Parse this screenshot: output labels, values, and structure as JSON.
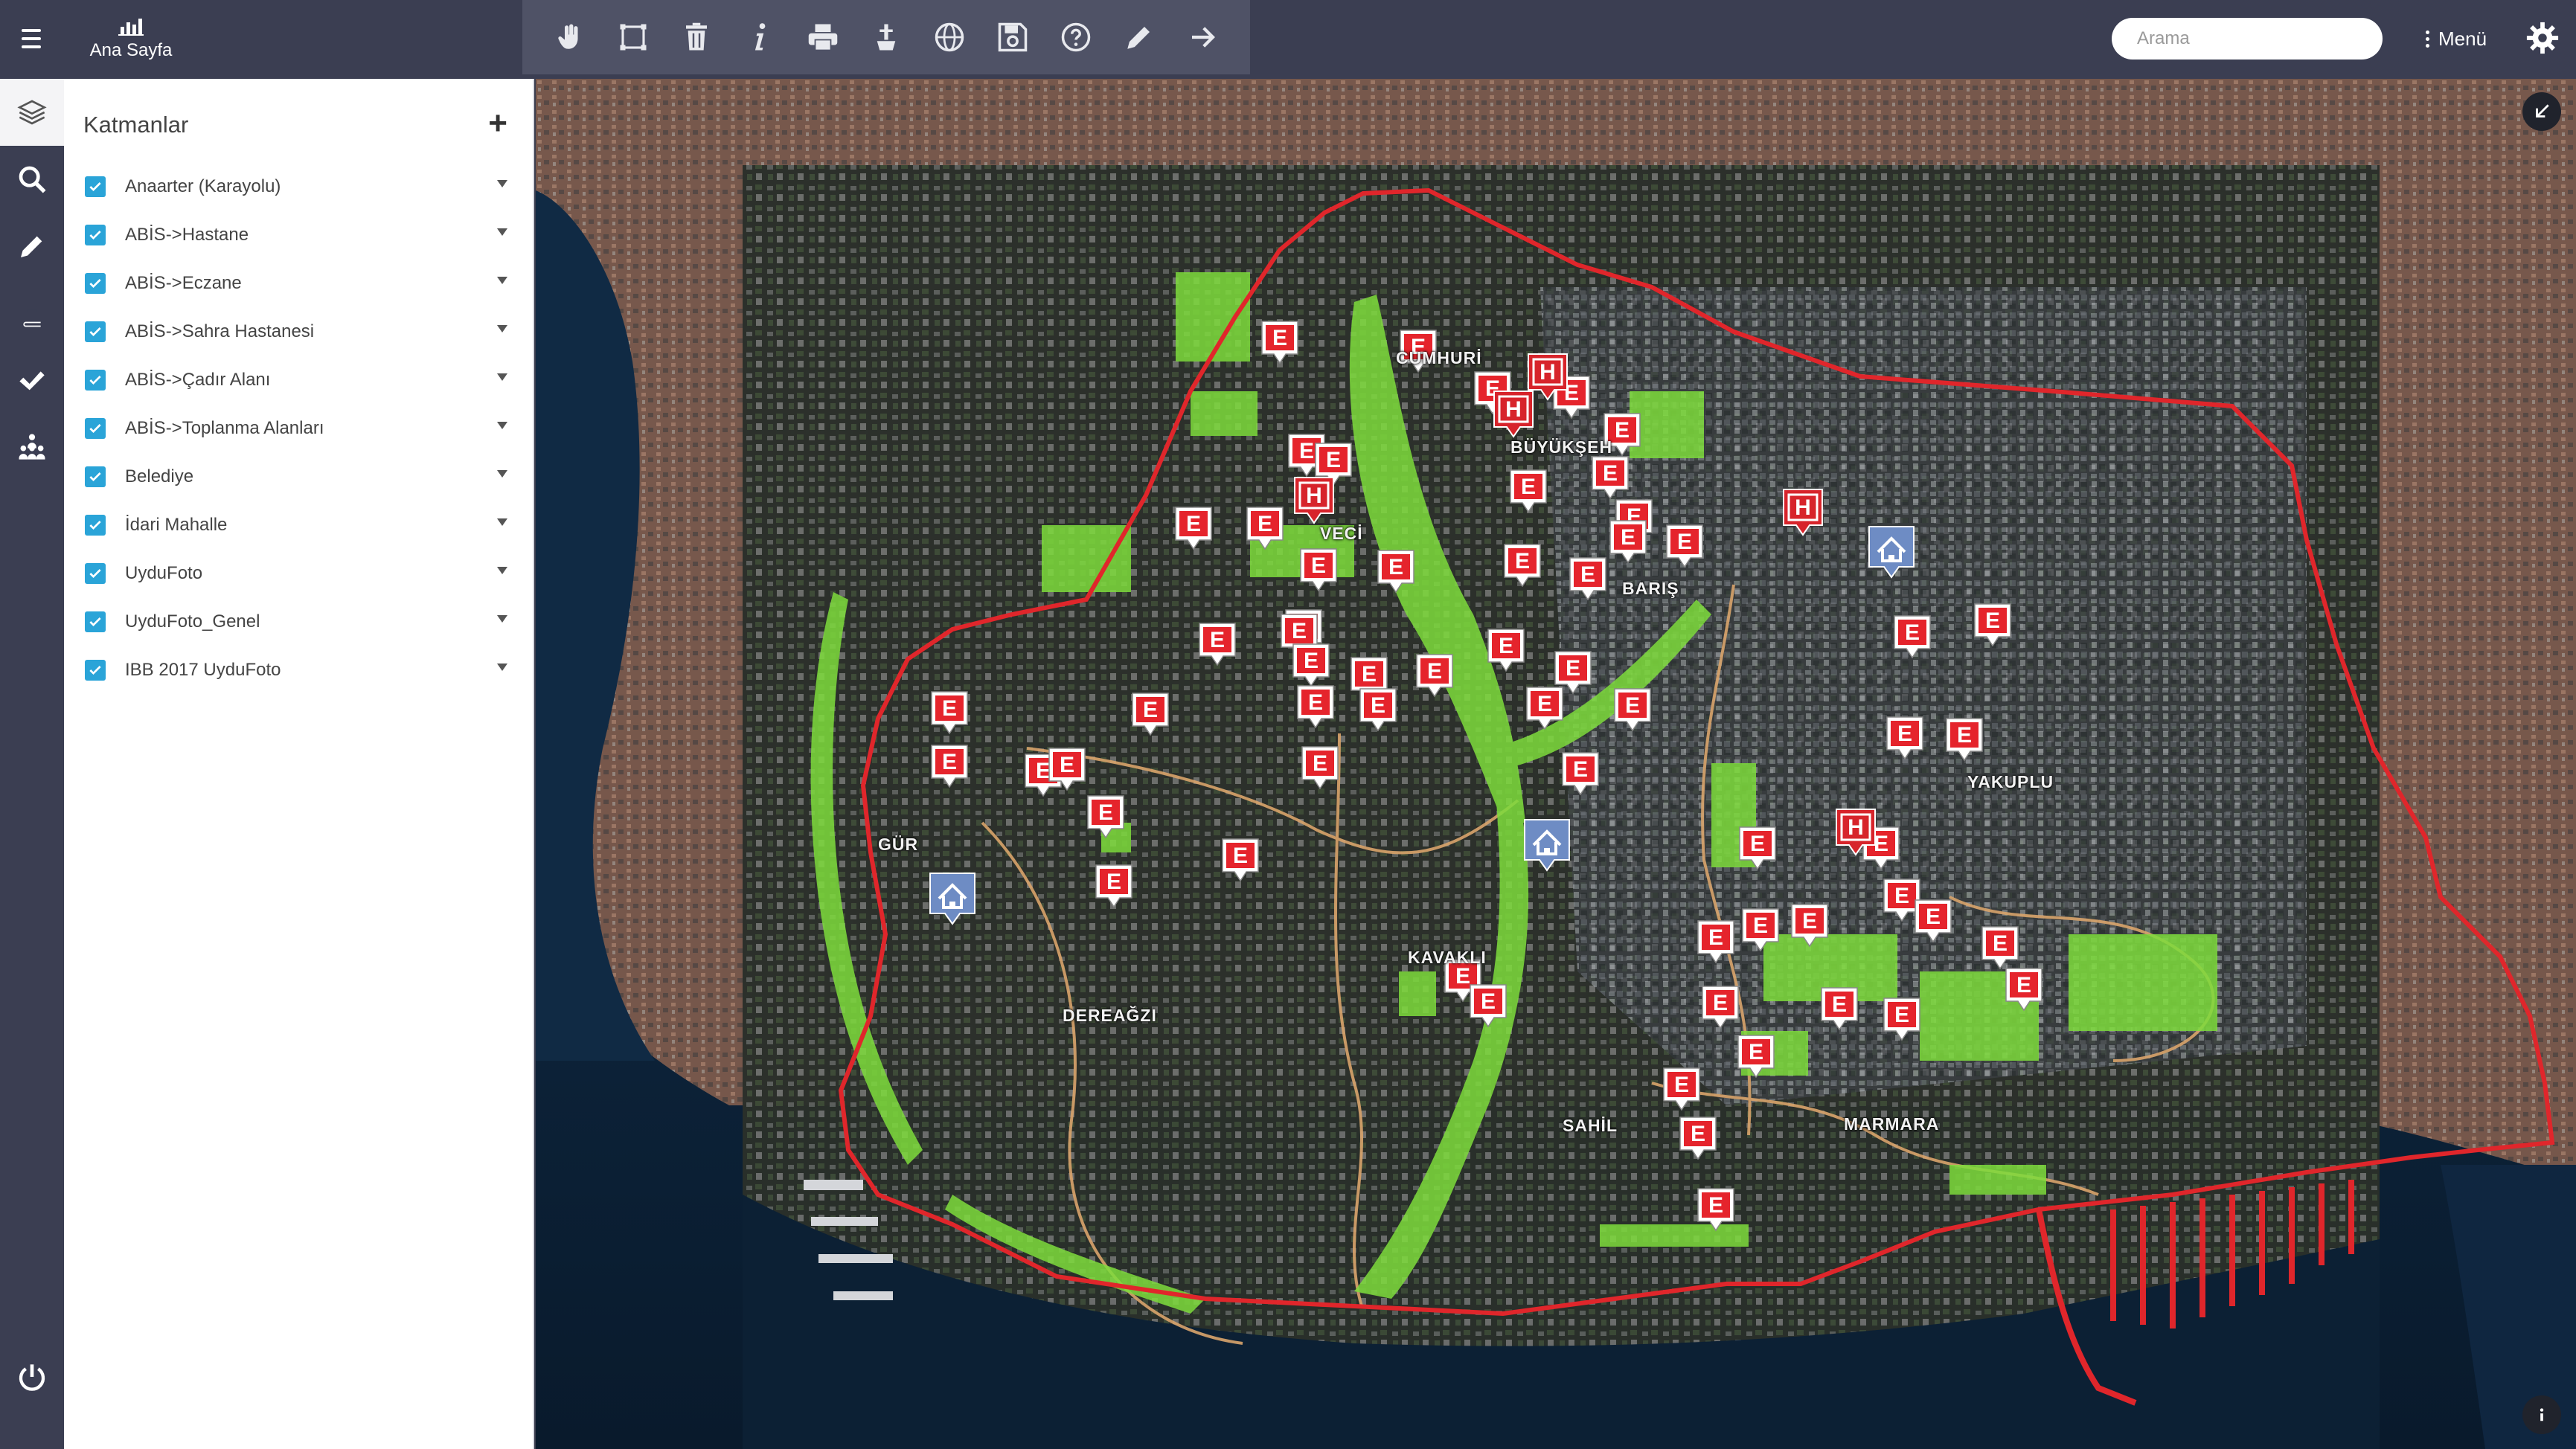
{
  "header": {
    "home_label": "Ana Sayfa",
    "search_placeholder": "Arama",
    "menu_label": "Menü"
  },
  "toolbar": {
    "tools": [
      "pan-hand-icon",
      "select-area-icon",
      "delete-icon",
      "info-icon",
      "print-icon",
      "measure-icon",
      "globe-icon",
      "save-icon",
      "help-icon",
      "draw-icon",
      "forward-icon"
    ]
  },
  "rail": {
    "items": [
      "layers-icon",
      "search-icon",
      "edit-icon",
      "book-icon",
      "check-icon",
      "users-icon"
    ],
    "active": "layers-icon"
  },
  "layers_panel": {
    "title": "Katmanlar",
    "layers": [
      {
        "label": "Anaarter (Karayolu)",
        "checked": true
      },
      {
        "label": "ABİS->Hastane",
        "checked": true
      },
      {
        "label": "ABİS->Eczane",
        "checked": true
      },
      {
        "label": "ABİS->Sahra Hastanesi",
        "checked": true
      },
      {
        "label": "ABİS->Çadır Alanı",
        "checked": true
      },
      {
        "label": "ABİS->Toplanma Alanları",
        "checked": true
      },
      {
        "label": "Belediye",
        "checked": true
      },
      {
        "label": "İdari Mahalle",
        "checked": true
      },
      {
        "label": "UyduFoto",
        "checked": true
      },
      {
        "label": "UyduFoto_Genel",
        "checked": true
      },
      {
        "label": "IBB 2017 UyduFoto",
        "checked": true
      }
    ]
  },
  "map": {
    "neighborhoods": [
      "CUMHURİ",
      "BÜYÜKŞEH",
      "VECİ",
      "BARIŞ",
      "GÜR",
      "DEREAĞZI",
      "KAVAKLI",
      "YAKUPLU",
      "SAHİL",
      "MARMARA"
    ],
    "markers": {
      "eczane_letter": "E",
      "hastane_letter": "H"
    },
    "colors": {
      "boundary": "#e0262b",
      "green_area": "#7edc3c",
      "road": "#d9a46b",
      "eczane_marker": "#e5242c",
      "hastane_marker": "#d7242b",
      "sea": "#0c2238"
    }
  }
}
